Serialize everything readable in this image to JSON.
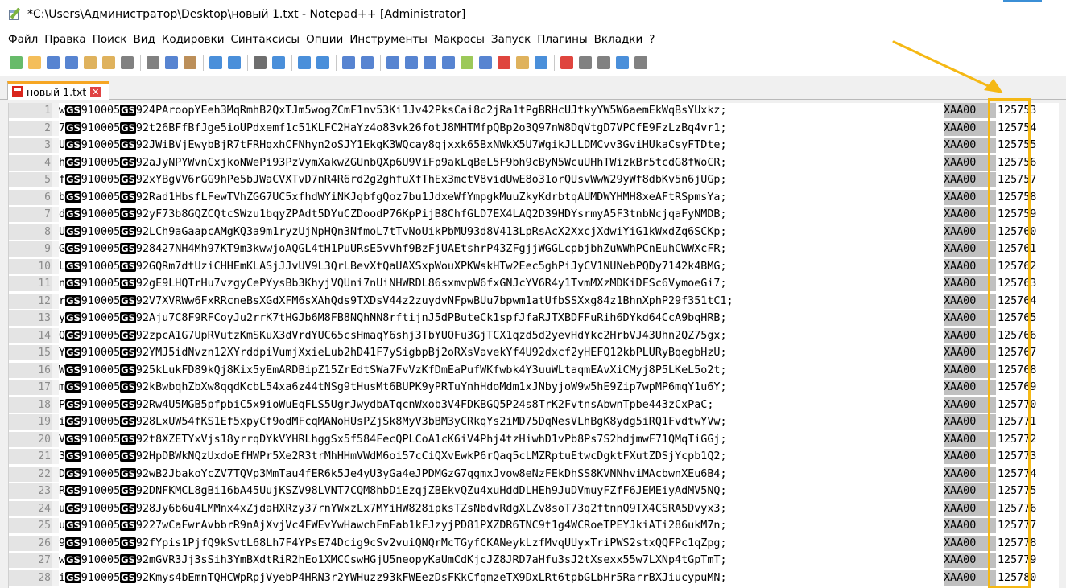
{
  "window": {
    "title": "*C:\\Users\\Администратор\\Desktop\\новый 1.txt - Notepad++ [Administrator]"
  },
  "menu": [
    "Файл",
    "Правка",
    "Поиск",
    "Вид",
    "Кодировки",
    "Синтаксисы",
    "Опции",
    "Инструменты",
    "Макросы",
    "Запуск",
    "Плагины",
    "Вкладки",
    "?"
  ],
  "toolbar": {
    "icons": [
      {
        "name": "new-file-icon",
        "color": "#4caf50"
      },
      {
        "name": "open-file-icon",
        "color": "#f2b33d"
      },
      {
        "name": "save-icon",
        "color": "#3a6fc9"
      },
      {
        "name": "save-all-icon",
        "color": "#3a6fc9"
      },
      {
        "name": "close-icon",
        "color": "#d9a441"
      },
      {
        "name": "close-all-icon",
        "color": "#d9a441"
      },
      {
        "name": "print-icon",
        "color": "#6b6b6b"
      },
      {
        "sep": true
      },
      {
        "name": "cut-icon",
        "color": "#6b6b6b"
      },
      {
        "name": "copy-icon",
        "color": "#3a6fc9"
      },
      {
        "name": "paste-icon",
        "color": "#b07b3c"
      },
      {
        "sep": true
      },
      {
        "name": "undo-icon",
        "color": "#2a7bd4"
      },
      {
        "name": "redo-icon",
        "color": "#2a7bd4"
      },
      {
        "sep": true
      },
      {
        "name": "find-icon",
        "color": "#555555"
      },
      {
        "name": "replace-icon",
        "color": "#2a7bd4"
      },
      {
        "sep": true
      },
      {
        "name": "zoom-in-icon",
        "color": "#2a7bd4"
      },
      {
        "name": "zoom-out-icon",
        "color": "#2a7bd4"
      },
      {
        "sep": true
      },
      {
        "name": "sync-vertical-icon",
        "color": "#3a6fc9"
      },
      {
        "name": "sync-horizontal-icon",
        "color": "#3a6fc9"
      },
      {
        "sep": true
      },
      {
        "name": "word-wrap-icon",
        "color": "#3a6fc9"
      },
      {
        "name": "show-all-chars-icon",
        "color": "#3a6fc9"
      },
      {
        "name": "indent-guide-icon",
        "color": "#3a6fc9"
      },
      {
        "name": "user-language-icon",
        "color": "#3a6fc9"
      },
      {
        "name": "doc-map-icon",
        "color": "#8bbf3c"
      },
      {
        "name": "function-list-icon",
        "color": "#3a6fc9"
      },
      {
        "name": "folder-workspace-icon",
        "color": "#d9251c"
      },
      {
        "name": "folder-icon",
        "color": "#d9a441"
      },
      {
        "name": "monitor-icon",
        "color": "#2a7bd4"
      },
      {
        "sep": true
      },
      {
        "name": "record-macro-icon",
        "color": "#d9251c"
      },
      {
        "name": "stop-macro-icon",
        "color": "#6b6b6b"
      },
      {
        "name": "play-macro-icon",
        "color": "#6b6b6b"
      },
      {
        "name": "run-macro-multiple-icon",
        "color": "#2a7bd4"
      },
      {
        "name": "save-macro-icon",
        "color": "#6b6b6b"
      }
    ]
  },
  "tab": {
    "name": "новый 1.txt",
    "close": "✕"
  },
  "separator_label": "GS",
  "lines": [
    {
      "n": "1",
      "p": "w",
      "m": "924PAroopYEeh3MqRmhB2QxTJm5wogZCmF1nv53Ki1Jv42PksCai8c2jRa1tPgBRHcUJtkyYW5W6aemEkWqBsYUxkz;",
      "t": "XAA00",
      "v": "125753"
    },
    {
      "n": "2",
      "p": "7",
      "m": "92t26BFfBfJge5ioUPdxemf1c51KLFC2HaYz4o83vk26fotJ8MHTMfpQBp2o3Q97nW8DqVtgD7VPCfE9FzLzBq4vr1;",
      "t": "XAA00",
      "v": "125754"
    },
    {
      "n": "3",
      "p": "U",
      "m": "92JWiBVjEwybBjR7tFRHqxhCFNhyn2oSJY1EkgK3WQcay8qjxxk65BxNWkX5U7WgikJLLDMCvv3GviHUkaCsyFTDte;",
      "t": "XAA00",
      "v": "125755"
    },
    {
      "n": "4",
      "p": "h",
      "m": "92aJyNPYWvnCxjkoNWePi93PzVymXakwZGUnbQXp6U9ViFp9akLqBeL5F9bh9cByN5WcuUHhTWizkBr5tcdG8fWoCR;",
      "t": "XAA00",
      "v": "125756"
    },
    {
      "n": "5",
      "p": "f",
      "m": "92xYBgVV6rGG9hPe5bJWaCVXTvD7nR4R6rd2g2ghfuXfThEx3mctV8vidUwE8o31orQUsvWwW29yWf8dbKv5n6jUGp;",
      "t": "XAA00",
      "v": "125757"
    },
    {
      "n": "6",
      "p": "b",
      "m": "92Rad1HbsfLFewTVhZGG7UC5xfhdWYiNKJqbfgQoz7bu1JdxeWfYmpgkMuuZkyKdrbtqAUMDWYHMH8xeAFtRSpmsYa;",
      "t": "XAA00",
      "v": "125758"
    },
    {
      "n": "7",
      "p": "d",
      "m": "92yF73b8GQZCQtcSWzu1bqyZPAdt5DYuCZDoodP76KpPijB8ChfGLD7EX4LAQ2D39HDYsrmyA5F3tnbNcjqaFyNMDB;",
      "t": "XAA00",
      "v": "125759"
    },
    {
      "n": "8",
      "p": "U",
      "m": "92LCh9aGaapcAMgKQ3a9m1ryzUjNpHQn3NfmoL7tTvNoUikPbMU93d8V413LpRsAcX2XxcjXdwiYiG1kWxdZq6SCKp;",
      "t": "XAA00",
      "v": "125760"
    },
    {
      "n": "9",
      "p": "G",
      "m": "928427NH4Mh97KT9m3kwwjoAQGL4tH1PuURsE5vVhf9BzFjUAEtshrP43ZFgjjWGGLcpbjbhZuWWhPCnEuhCWWXcFR;",
      "t": "XAA00",
      "v": "125761"
    },
    {
      "n": "10",
      "p": "L",
      "m": "92GQRm7dtUziCHHEmKLASjJJvUV9L3QrLBevXtQaUAXSxpWouXPKWskHTw2Eec5ghPiJyCV1NUNebPQDy7142k4BMG;",
      "t": "XAA00",
      "v": "125762"
    },
    {
      "n": "11",
      "p": "n",
      "m": "92gE9LHQTrHu7vzgyCePYysBb3KhyjVQUni7nUiNHWRDL86sxmvpW6fxGNJcYV6R4y1TvmMXzMDKiDFSc6VymoeGi7;",
      "t": "XAA00",
      "v": "125763"
    },
    {
      "n": "12",
      "p": "r",
      "m": "92V7XVRWw6FxRRcneBsXGdXFM6sXAhQds9TXDsV44z2zuydvNFpwBUu7bpwm1atUfbSSXxg84z1BhnXphP29f351tC1;",
      "t": "XAA00",
      "v": "125764"
    },
    {
      "n": "13",
      "p": "y",
      "m": "92Aju7C8F9RFCoyJu2rrK7tHGJb6M8FB8NQhNN8rftijnJ5dPButeCk1spfJfaRJTXBDFFuRih6DYkd64CcA9bqHRB;",
      "t": "XAA00",
      "v": "125765"
    },
    {
      "n": "14",
      "p": "Q",
      "m": "92zpcA1G7UpRVutzKmSKuX3dVrdYUC65csHmaqY6shj3TbYUQFu3GjTCX1qzd5d2yevHdYkc2HrbVJ43Uhn2QZ75gx;",
      "t": "XAA00",
      "v": "125766"
    },
    {
      "n": "15",
      "p": "Y",
      "m": "92YMJ5idNvzn12XYrddpiVumjXxieLub2hD41F7ySigbpBj2oRXsVavekYf4U92dxcf2yHEFQ12kbPLURyBqegbHzU;",
      "t": "XAA00",
      "v": "125767"
    },
    {
      "n": "16",
      "p": "W",
      "m": "925kLukFD89kQj8Kix5yEmARDBipZ15ZrEdtSWa7FvVzKfDmEaPufWKfwbk4Y3uuWLtaqmEAvXiCMyj8P5LKeL5o2t;",
      "t": "XAA00",
      "v": "125768"
    },
    {
      "n": "17",
      "p": "m",
      "m": "92kBwbqhZbXw8qqdKcbL54xa6z44tNSg9tHusMt6BUPK9yPRTuYnhHdoMdm1xJNbyjoW9w5hE9Zip7wpMP6mqY1u6Y;",
      "t": "XAA00",
      "v": "125769"
    },
    {
      "n": "18",
      "p": "P",
      "m": "92Rw4U5MGB5pfpbiC5x9ioWuEqFLS5UgrJwydbATqcnWxob3V4FDKBGQ5P24s8TrK2FvtnsAbwnTpbe443zCxPaC;",
      "t": "XAA00",
      "v": "125770"
    },
    {
      "n": "19",
      "p": "i",
      "m": "928LxUW54fKS1Ef5xpyCf9odMFcqMANoHUsPZjSk8MyV3bBM3yCRkqYs2iMD75DqNesVLhBgK8ydg5iRQ1FvdtwYVw;",
      "t": "XAA00",
      "v": "125771"
    },
    {
      "n": "20",
      "p": "V",
      "m": "92t8XZETYxVjs18yrrqDYkVYHRLhggSx5f584FecQPLCoA1cK6iV4Phj4tzHiwhD1vPb8Ps7S2hdjmwF71QMqTiGGj;",
      "t": "XAA00",
      "v": "125772"
    },
    {
      "n": "21",
      "p": "3",
      "m": "92HpDBWkNQzUxdoEfHWPr5Xe2R3trMhHHmVWdM6oi57cCiQXvEwkP6rQaq5cLMZRptuEtwcDgktFXutZDSjYcpb1Q2;",
      "t": "XAA00",
      "v": "125773"
    },
    {
      "n": "22",
      "p": "D",
      "m": "92wB2JbakoYcZV7TQVp3MmTau4fER6k5Je4yU3yGa4eJPDMGzG7qgmxJvow8eNzFEkDhSS8KVNNhviMAcbwnXEu6B4;",
      "t": "XAA00",
      "v": "125774"
    },
    {
      "n": "23",
      "p": "R",
      "m": "92DNFKMCL8gBi16bA45UujKSZV98LVNT7CQM8hbDiEzqjZBEkvQZu4xuHddDLHEh9JuDVmuyFZfF6JEMEiyAdMV5NQ;",
      "t": "XAA00",
      "v": "125775"
    },
    {
      "n": "24",
      "p": "u",
      "m": "928Jy6b6u4LMMnx4xZjdaHXRzy37rnYWxzLx7MYiHW828ipksTZsNbdvRdgXLZv8soT73q2ftnnQ9TX4CSRA5Dvyx3;",
      "t": "XAA00",
      "v": "125776"
    },
    {
      "n": "25",
      "p": "u",
      "m": "9227wCaFwrAvbbrR9nAjXvjVc4FWEvYwHawchFmFab1kFJzyjPD81PXZDR6TNC9t1g4WCRoeTPEYJkiATi286ukM7n;",
      "t": "XAA00",
      "v": "125777"
    },
    {
      "n": "26",
      "p": "9",
      "m": "92fYpis1PjfQ9kSvtL68Lh7F4YPsE74Dcig9cSv2vuiQNQrMcTGyfCKANeykLzfMvqUUyxTriPWS2stxQQFPc1qZpg;",
      "t": "XAA00",
      "v": "125778"
    },
    {
      "n": "27",
      "p": "w",
      "m": "92mGVR3Jj3sSih3YmBXdtRiR2hEo1XMCCswHGjU5neopyKaUmCdKjcJZ8JRD7aHfu3sJ2tXsexx55w7LXNp4tGpTmT;",
      "t": "XAA00",
      "v": "125779"
    },
    {
      "n": "28",
      "p": "i",
      "m": "92Kmys4bEmnTQHCWpRpjVyebP4HRN3r2YWHuzz93kFWEezDsFKkCfqmzeTX9DxLRt6tpbGLbHr5RarrBXJiucypuMN;",
      "t": "XAA00",
      "v": "125780"
    }
  ],
  "constant_field": "910005"
}
